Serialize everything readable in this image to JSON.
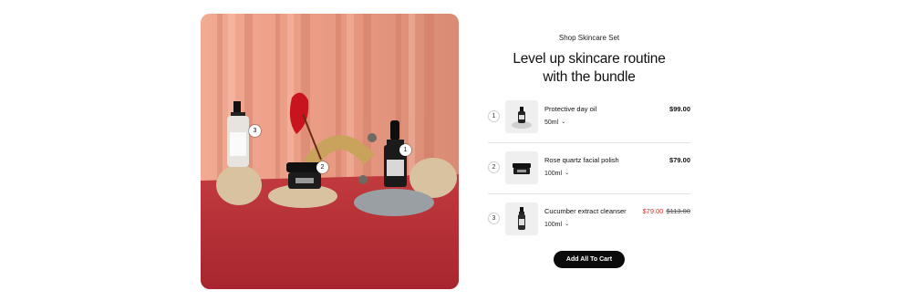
{
  "hero": {
    "hotspots": [
      "1",
      "2",
      "3"
    ]
  },
  "bundle": {
    "eyebrow": "Shop Skincare Set",
    "headline_line1": "Level up skincare routine",
    "headline_line2": "with the bundle",
    "items": [
      {
        "index": "1",
        "name": "Protective day oil",
        "variant": "50ml",
        "price": "$99.00"
      },
      {
        "index": "2",
        "name": "Rose quartz facial polish",
        "variant": "100ml",
        "price": "$79.00"
      },
      {
        "index": "3",
        "name": "Cucumber extract cleanser",
        "variant": "100ml",
        "sale_price": "$79.00",
        "compare_price": "$113.00"
      }
    ],
    "cta": "Add All To Cart"
  },
  "colors": {
    "background": "#ffffff",
    "backdrop": "#e99a82",
    "table": "#b8303a",
    "button": "#0b0b0b",
    "sale_price": "#d0342c"
  },
  "icons": {
    "variant_toggle": "chevron-down-icon"
  }
}
